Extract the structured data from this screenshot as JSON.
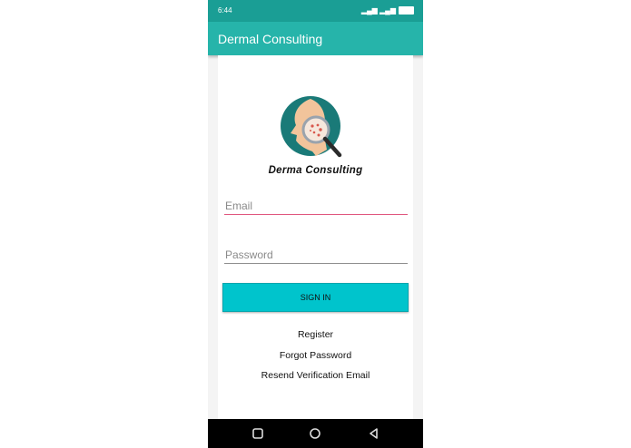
{
  "status_bar": {
    "time": "6:44",
    "extra": "ⓟ ···",
    "signal": "▂▄▆ ▂▄▆"
  },
  "app_bar": {
    "title": "Dermal Consulting"
  },
  "logo": {
    "brand_text": "Derma Consulting"
  },
  "form": {
    "email_placeholder": "Email",
    "email_value": "",
    "password_placeholder": "Password",
    "password_value": "",
    "sign_in_label": "SIGN IN"
  },
  "links": {
    "register": "Register",
    "forgot_password": "Forgot Password",
    "resend_verification": "Resend Verification Email"
  },
  "nav_bar": {
    "icons": [
      "square-icon",
      "circle-icon",
      "back-triangle-icon"
    ]
  },
  "colors": {
    "status_bar": "#1a9e95",
    "app_bar": "#26b4aa",
    "accent_pink": "#e0577f",
    "button": "#00c4cc",
    "logo_teal": "#1a7a78",
    "nav_bar": "#000000"
  }
}
